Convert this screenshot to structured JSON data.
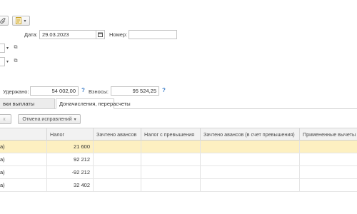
{
  "toolbar": {
    "attach_icon": "paperclip-icon",
    "report_icon": "document-report-icon"
  },
  "header": {
    "date_label": "Дата:",
    "date_value": "29.03.2023",
    "number_label": "Номер:",
    "number_value": ""
  },
  "totals": {
    "withheld_label": "Удержано:",
    "withheld_value": "54 002,00",
    "contributions_label": "Взносы:",
    "contributions_value": "95 524,25",
    "help_mark": "?"
  },
  "tabs": [
    {
      "label": "вки выплаты",
      "active": false
    },
    {
      "label": "Доначисления, перерасчеты",
      "active": true
    }
  ],
  "subtoolbar": {
    "disabled_button": "к",
    "cancel_corrections_label": "Отмена исправлений",
    "dropdown_arrow": "▾"
  },
  "table": {
    "columns": [
      "",
      "Налог",
      "Зачтено авансов",
      "Налог с превышения",
      "Зачтено авансов (в счет превышения)",
      "Примененные вычеты"
    ],
    "rows": [
      {
        "first": "а)",
        "tax": "21 600",
        "selected": true
      },
      {
        "first": "а)",
        "tax": "92 212",
        "selected": false
      },
      {
        "first": "а)",
        "tax": "-92 212",
        "selected": false
      },
      {
        "first": "а)",
        "tax": "32 402",
        "selected": false
      }
    ]
  }
}
